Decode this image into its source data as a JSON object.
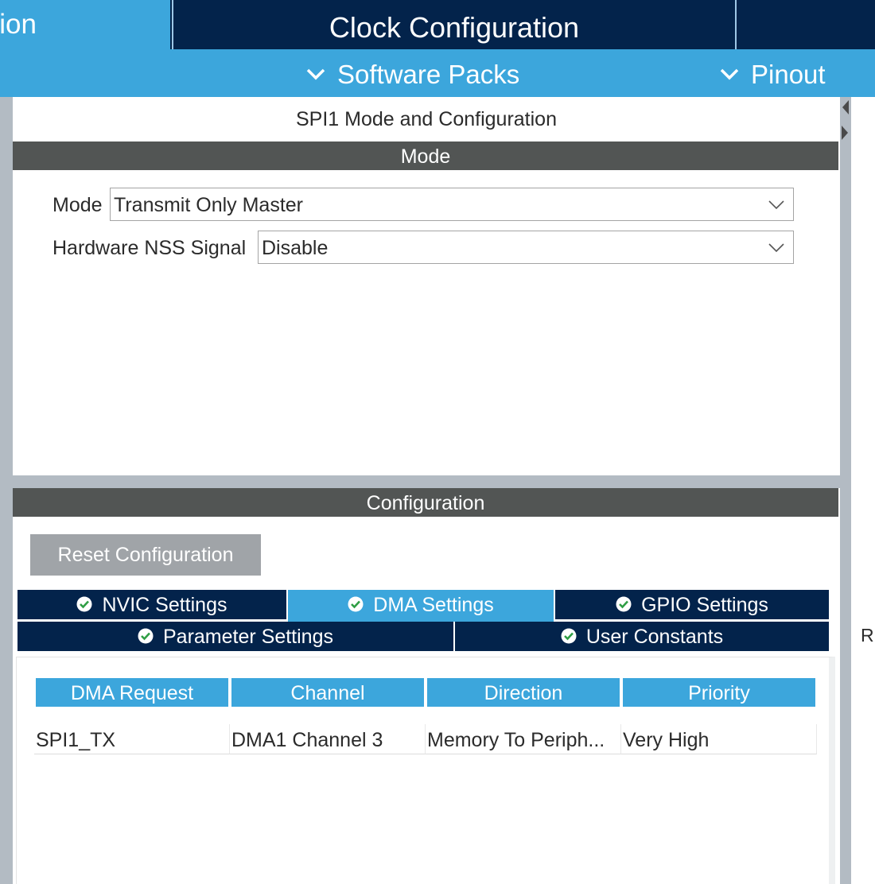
{
  "top_tabs": {
    "pinout_config_label": "Pinout & Configuration",
    "clock_config_label": "Clock Configuration"
  },
  "sub_menu": {
    "software_packs_label": "Software Packs",
    "pinout_label": "Pinout"
  },
  "mode_panel": {
    "title": "SPI1 Mode and Configuration",
    "section_label": "Mode",
    "mode_label": "Mode",
    "mode_value": "Transmit Only Master",
    "nss_label": "Hardware NSS Signal",
    "nss_value": "Disable"
  },
  "config_panel": {
    "section_label": "Configuration",
    "reset_button_label": "Reset Configuration",
    "tabs": [
      {
        "label": "NVIC Settings",
        "active": false
      },
      {
        "label": "DMA Settings",
        "active": true
      },
      {
        "label": "GPIO Settings",
        "active": false
      },
      {
        "label": "Parameter Settings",
        "active": false
      },
      {
        "label": "User Constants",
        "active": false
      }
    ],
    "dma_table": {
      "columns": [
        "DMA Request",
        "Channel",
        "Direction",
        "Priority"
      ],
      "rows": [
        [
          "SPI1_TX",
          "DMA1 Channel 3",
          "Memory To Periph...",
          "Very High"
        ]
      ]
    }
  },
  "right_edge_text": "R",
  "colors": {
    "navy": "#03234b",
    "accent_blue": "#3ca6dc",
    "section_bar": "#525554",
    "status_ok": "#2f9e44"
  }
}
